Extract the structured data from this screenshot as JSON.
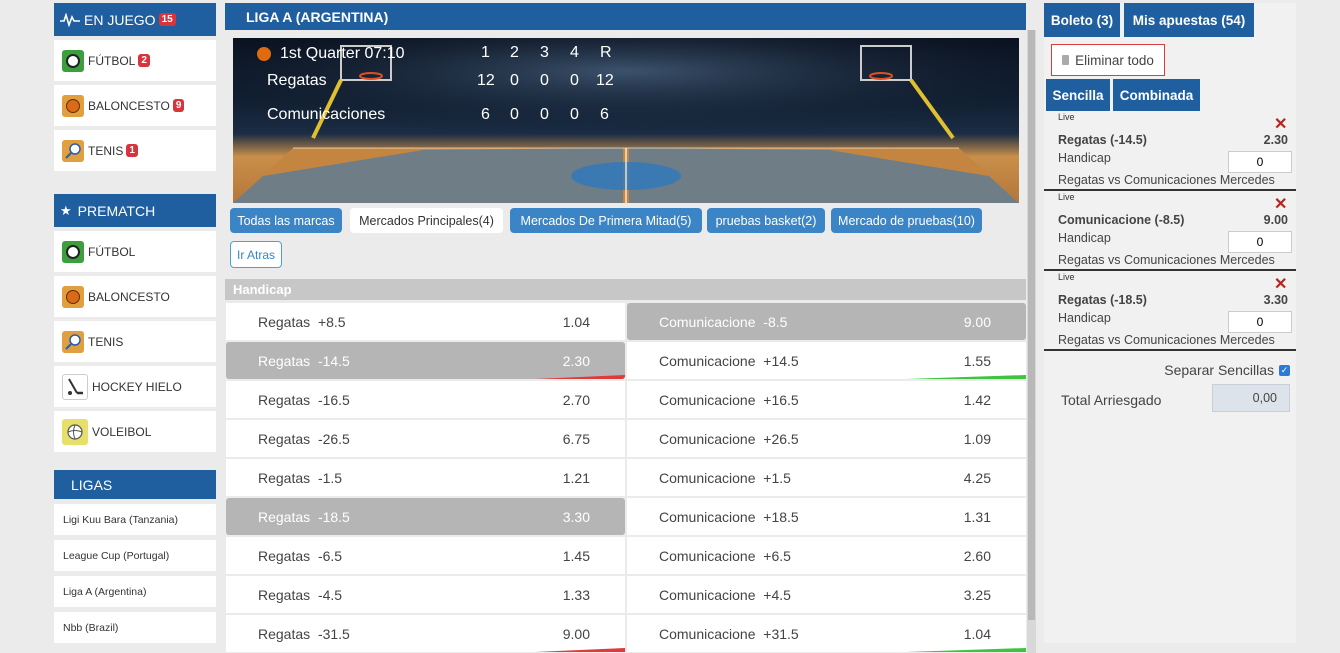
{
  "left": {
    "live_header": {
      "label": "EN JUEGO",
      "count": "15"
    },
    "live_sports": [
      {
        "label": "FÚTBOL",
        "count": "2",
        "icon": "soccer-ball-icon"
      },
      {
        "label": "BALONCESTO",
        "count": "9",
        "icon": "basketball-icon"
      },
      {
        "label": "TENIS",
        "count": "1",
        "icon": "tennis-racket-icon"
      }
    ],
    "prematch_header": {
      "label": "PREMATCH",
      "icon": "star-icon"
    },
    "prematch_sports": [
      {
        "label": "FÚTBOL",
        "icon": "soccer-ball-icon"
      },
      {
        "label": "BALONCESTO",
        "icon": "basketball-icon"
      },
      {
        "label": "TENIS",
        "icon": "tennis-racket-icon"
      },
      {
        "label": "HOCKEY HIELO",
        "icon": "hockey-stick-icon"
      },
      {
        "label": "VOLEIBOL",
        "icon": "volleyball-icon"
      }
    ],
    "ligas_header": {
      "label": "LIGAS"
    },
    "ligas": [
      "Ligi Kuu Bara (Tanzania)",
      "League Cup (Portugal)",
      "Liga A (Argentina)",
      "Nbb (Brazil)"
    ]
  },
  "center": {
    "league_title": "LIGA A (ARGENTINA)",
    "scoreboard": {
      "period": "1st Quarter 07:10",
      "columns": [
        "1",
        "2",
        "3",
        "4",
        "R"
      ],
      "teams": [
        {
          "name": "Regatas",
          "scores": [
            "12",
            "0",
            "0",
            "0",
            "12"
          ]
        },
        {
          "name": "Comunicaciones",
          "scores": [
            "6",
            "0",
            "0",
            "0",
            "6"
          ]
        }
      ]
    },
    "tabs": [
      {
        "label": "Todas las marcas",
        "active": false
      },
      {
        "label": "Mercados Principales(4)",
        "active": true
      },
      {
        "label": "Mercados De Primera Mitad(5)",
        "active": false
      },
      {
        "label": "pruebas basket(2)",
        "active": false
      },
      {
        "label": "Mercado de pruebas(10)",
        "active": false
      }
    ],
    "back_button": "Ir Atras",
    "market_title": "Handicap",
    "odds_rows": [
      {
        "left": {
          "team": "Regatas",
          "line": "+8.5",
          "odds": "1.04",
          "selected": false,
          "trend": ""
        },
        "right": {
          "team": "Comunicacione",
          "line": "-8.5",
          "odds": "9.00",
          "selected": true,
          "trend": ""
        }
      },
      {
        "left": {
          "team": "Regatas",
          "line": "-14.5",
          "odds": "2.30",
          "selected": true,
          "trend": "down"
        },
        "right": {
          "team": "Comunicacione",
          "line": "+14.5",
          "odds": "1.55",
          "selected": false,
          "trend": "up"
        }
      },
      {
        "left": {
          "team": "Regatas",
          "line": "-16.5",
          "odds": "2.70",
          "selected": false,
          "trend": ""
        },
        "right": {
          "team": "Comunicacione",
          "line": "+16.5",
          "odds": "1.42",
          "selected": false,
          "trend": ""
        }
      },
      {
        "left": {
          "team": "Regatas",
          "line": "-26.5",
          "odds": "6.75",
          "selected": false,
          "trend": ""
        },
        "right": {
          "team": "Comunicacione",
          "line": "+26.5",
          "odds": "1.09",
          "selected": false,
          "trend": ""
        }
      },
      {
        "left": {
          "team": "Regatas",
          "line": "-1.5",
          "odds": "1.21",
          "selected": false,
          "trend": ""
        },
        "right": {
          "team": "Comunicacione",
          "line": "+1.5",
          "odds": "4.25",
          "selected": false,
          "trend": ""
        }
      },
      {
        "left": {
          "team": "Regatas",
          "line": "-18.5",
          "odds": "3.30",
          "selected": true,
          "trend": ""
        },
        "right": {
          "team": "Comunicacione",
          "line": "+18.5",
          "odds": "1.31",
          "selected": false,
          "trend": ""
        }
      },
      {
        "left": {
          "team": "Regatas",
          "line": "-6.5",
          "odds": "1.45",
          "selected": false,
          "trend": ""
        },
        "right": {
          "team": "Comunicacione",
          "line": "+6.5",
          "odds": "2.60",
          "selected": false,
          "trend": ""
        }
      },
      {
        "left": {
          "team": "Regatas",
          "line": "-4.5",
          "odds": "1.33",
          "selected": false,
          "trend": ""
        },
        "right": {
          "team": "Comunicacione",
          "line": "+4.5",
          "odds": "3.25",
          "selected": false,
          "trend": ""
        }
      },
      {
        "left": {
          "team": "Regatas",
          "line": "-31.5",
          "odds": "9.00",
          "selected": false,
          "trend": "down"
        },
        "right": {
          "team": "Comunicacione",
          "line": "+31.5",
          "odds": "1.04",
          "selected": false,
          "trend": "up"
        }
      }
    ]
  },
  "right": {
    "tab_boleto": "Boleto (3)",
    "tab_apuestas": "Mis apuestas (54)",
    "delete_all": "Eliminar todo",
    "tab_sencilla": "Sencilla",
    "tab_combinada": "Combinada",
    "slips": [
      {
        "live": "Live",
        "selection": "Regatas (-14.5)",
        "odds": "2.30",
        "market": "Handicap",
        "stake": "0",
        "event": "Regatas vs Comunicaciones Mercedes"
      },
      {
        "live": "Live",
        "selection": "Comunicacione (-8.5)",
        "odds": "9.00",
        "market": "Handicap",
        "stake": "0",
        "event": "Regatas vs Comunicaciones Mercedes"
      },
      {
        "live": "Live",
        "selection": "Regatas (-18.5)",
        "odds": "3.30",
        "market": "Handicap",
        "stake": "0",
        "event": "Regatas vs Comunicaciones Mercedes"
      }
    ],
    "separate_singles": "Separar Sencillas",
    "separate_checked": true,
    "total_label": "Total Arriesgado",
    "total_value": "0,00"
  },
  "colors": {
    "primary": "#1f5fa0",
    "tab_blue": "#3b85c6",
    "badge_red": "#d8343e",
    "selected_gray": "#b5b5b5",
    "trend_up": "#3ec43e",
    "trend_down": "#e03a3a"
  }
}
